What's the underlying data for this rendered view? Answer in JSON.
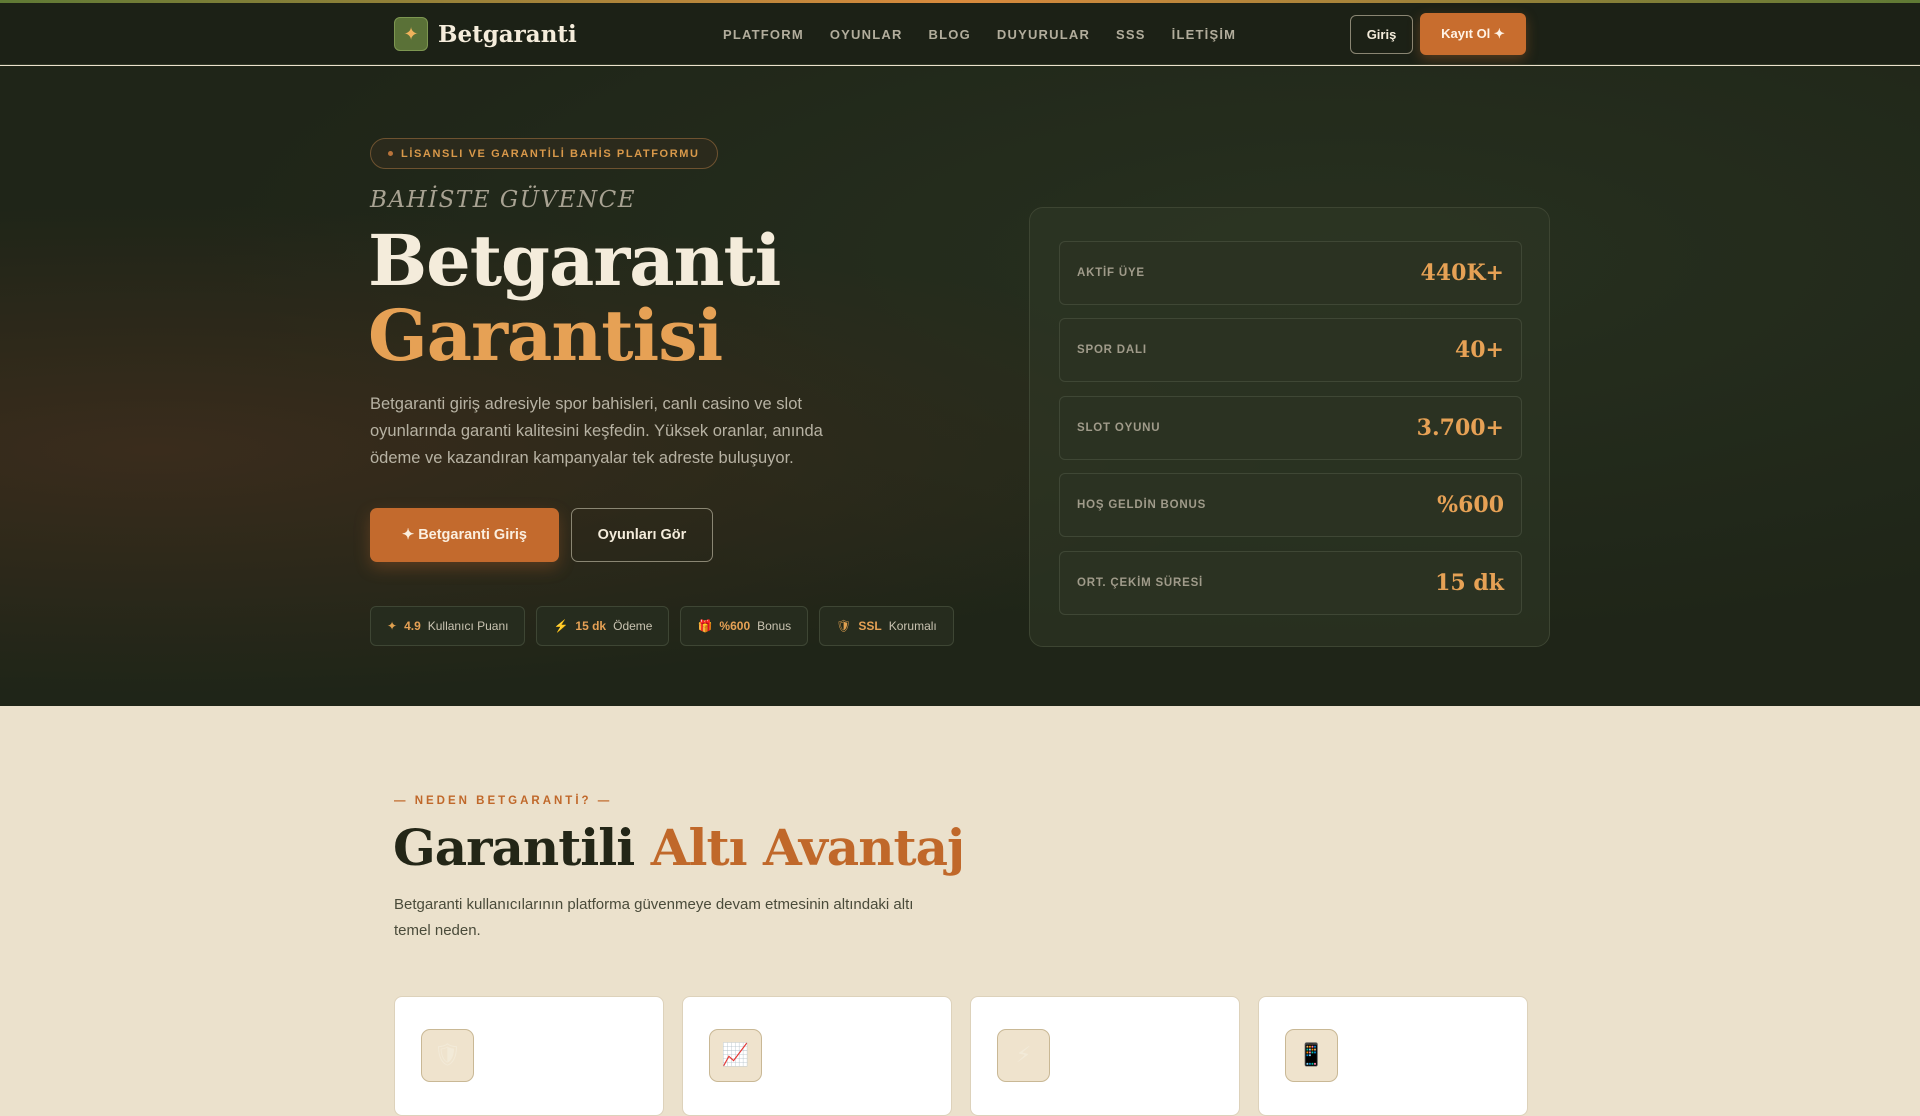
{
  "brand": {
    "name": "Betgaranti",
    "mark_icon": "sparkle-icon"
  },
  "nav": {
    "items": [
      "PLATFORM",
      "OYUNLAR",
      "BLOG",
      "DUYURULAR",
      "SSS",
      "İLETİŞİM"
    ]
  },
  "header": {
    "login_label": "Giriş",
    "register_label": "Kayıt Ol ✦"
  },
  "hero": {
    "pill": "LİSANSLI VE GARANTİLİ BAHİS PLATFORMU",
    "kicker": "BAHİSTE GÜVENCE",
    "title_line1": "Betgaranti",
    "title_line2": "Garantisi",
    "lead": "Betgaranti giriş adresiyle spor bahisleri, canlı casino ve slot oyunlarında garanti kalitesini keşfedin. Yüksek oranlar, anında ödeme ve kazandıran kampanyalar tek adreste buluşuyor.",
    "cta_primary": "✦ Betgaranti Giriş",
    "cta_secondary": "Oyunları Gör",
    "chips": [
      {
        "icon": "✦",
        "icon_name": "star-icon",
        "value": "4.9",
        "label": "Kullanıcı Puanı"
      },
      {
        "icon": "⚡",
        "icon_name": "lightning-icon",
        "value": "15 dk",
        "label": "Ödeme"
      },
      {
        "icon": "🎁",
        "icon_name": "gift-icon",
        "value": "%600",
        "label": "Bonus"
      },
      {
        "icon": "🛡",
        "icon_name": "shield-icon",
        "value": "SSL",
        "label": "Korumalı"
      }
    ]
  },
  "stats": [
    {
      "label": "AKTİF ÜYE",
      "value": "440K+"
    },
    {
      "label": "SPOR DALI",
      "value": "40+"
    },
    {
      "label": "SLOT OYUNU",
      "value": "3.700+"
    },
    {
      "label": "HOŞ GELDİN BONUS",
      "value": "%600"
    },
    {
      "label": "ORT. ÇEKİM SÜRESİ",
      "value": "15 dk"
    }
  ],
  "why": {
    "eyebrow": "— NEDEN BETGARANTİ? —",
    "title_plain": "Garantili ",
    "title_accent": "Altı Avantaj",
    "subtitle": "Betgaranti kullanıcılarının platforma güvenmeye devam etmesinin altındaki altı temel neden.",
    "cards": [
      {
        "icon": "🛡",
        "icon_name": "shield-icon"
      },
      {
        "icon": "📈",
        "icon_name": "chart-up-icon"
      },
      {
        "icon": "⚡",
        "icon_name": "lightning-icon"
      },
      {
        "icon": "📱",
        "icon_name": "mobile-icon"
      }
    ]
  },
  "colors": {
    "accent": "#c86d2e",
    "gold": "#e6a155",
    "dark_bg": "#1f2518",
    "light_bg": "#ebe1cc"
  }
}
